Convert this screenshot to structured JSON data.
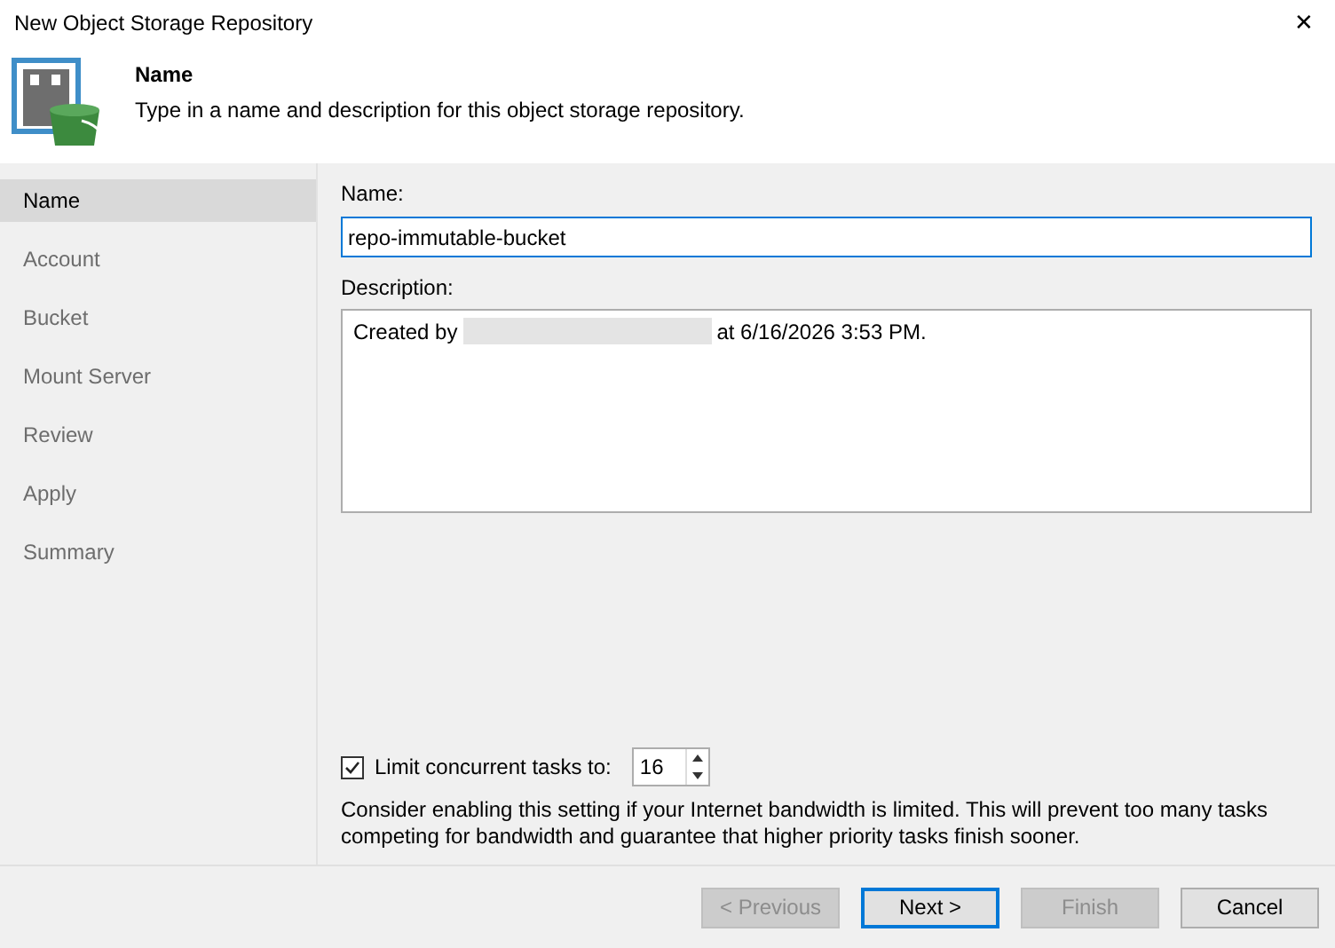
{
  "window": {
    "title": "New Object Storage Repository",
    "close": "✕"
  },
  "header": {
    "title": "Name",
    "subtitle": "Type in a name and description for this object storage repository."
  },
  "steps": [
    {
      "label": "Name",
      "selected": true
    },
    {
      "label": "Account",
      "selected": false
    },
    {
      "label": "Bucket",
      "selected": false
    },
    {
      "label": "Mount Server",
      "selected": false
    },
    {
      "label": "Review",
      "selected": false
    },
    {
      "label": "Apply",
      "selected": false
    },
    {
      "label": "Summary",
      "selected": false
    }
  ],
  "name_field": {
    "label": "Name:",
    "value": "repo-immutable-bucket"
  },
  "description_field": {
    "label": "Description:",
    "text_before": "Created by",
    "text_after": "at 6/16/2026 3:53 PM."
  },
  "limit": {
    "label": "Limit concurrent tasks to:",
    "checked": true,
    "value": "16",
    "hint": "Consider enabling this setting if your Internet bandwidth is limited. This will prevent too many tasks competing for bandwidth and guarantee that higher priority tasks finish sooner."
  },
  "buttons": [
    {
      "label": "< Previous",
      "disabled": true,
      "default": false
    },
    {
      "label": "Next >",
      "disabled": false,
      "default": true
    },
    {
      "label": "Finish",
      "disabled": true,
      "default": false
    },
    {
      "label": "Cancel",
      "disabled": false,
      "default": false
    }
  ]
}
